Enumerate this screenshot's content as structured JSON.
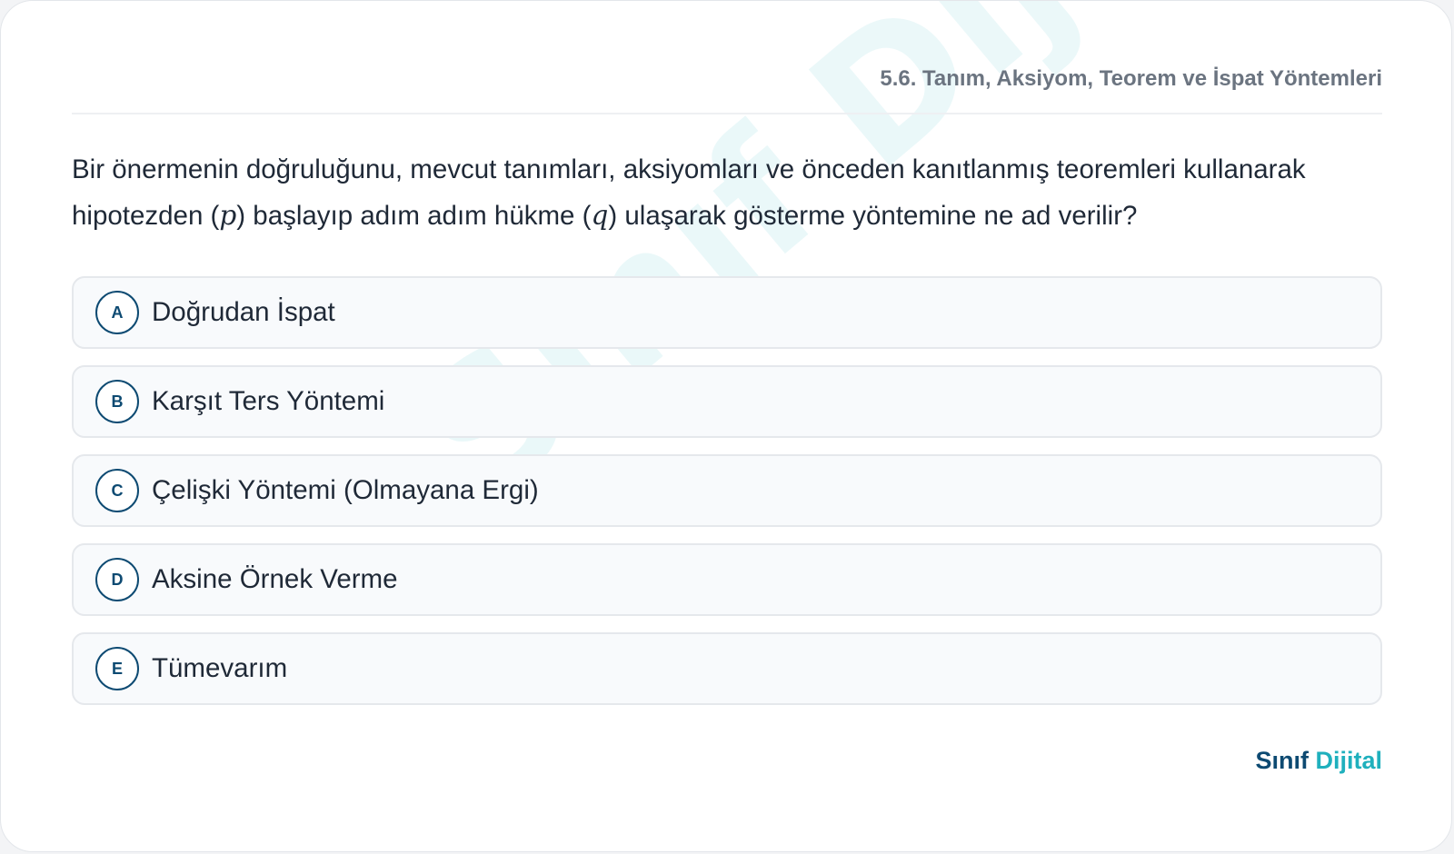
{
  "topic": "5.6. Tanım, Aksiyom, Teorem ve İspat Yöntemleri",
  "question": {
    "line1": "Bir önermenin doğruluğunu, mevcut tanımları, aksiyomları ve önceden kanıtlanmış teoremleri kullanarak",
    "line2_a": "hipotezden (",
    "var_p": "p",
    "line2_b": ") başlayıp adım adım hükme (",
    "var_q": "q",
    "line2_c": ") ulaşarak gösterme yöntemine ne ad verilir?"
  },
  "options": [
    {
      "letter": "A",
      "text": "Doğrudan İspat"
    },
    {
      "letter": "B",
      "text": "Karşıt Ters Yöntemi"
    },
    {
      "letter": "C",
      "text": "Çelişki Yöntemi (Olmayana Ergi)"
    },
    {
      "letter": "D",
      "text": "Aksine Örnek Verme"
    },
    {
      "letter": "E",
      "text": "Tümevarım"
    }
  ],
  "brand": {
    "part1": "Sınıf",
    "part2": "Dijital"
  },
  "watermark": "Sınıf Dijital",
  "colors": {
    "accent_dark": "#0d4a72",
    "accent_teal": "#1fb0bd",
    "option_bg": "#f8fafc",
    "text": "#1f2937",
    "muted": "#6b7480"
  }
}
